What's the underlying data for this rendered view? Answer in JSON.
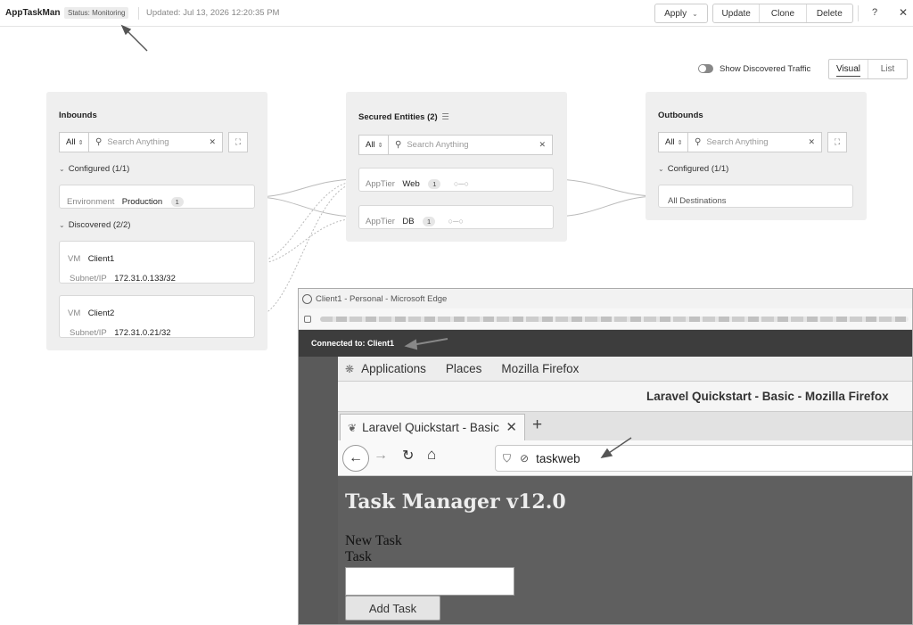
{
  "header": {
    "app_name": "AppTaskMan",
    "status": "Status: Monitoring",
    "updated": "Updated: Jul 13, 2026 12:20:35 PM",
    "apply": "Apply",
    "apply_chevron": "⌄",
    "update": "Update",
    "clone": "Clone",
    "delete": "Delete",
    "help": "?",
    "close": "✕"
  },
  "view": {
    "show_traffic": "Show Discovered Traffic",
    "visual": "Visual",
    "list": "List"
  },
  "inbounds": {
    "title": "Inbounds",
    "filter": "All",
    "search_placeholder": "Search Anything",
    "configured": "Configured (1/1)",
    "env_label": "Environment",
    "env_value": "Production",
    "env_count": "1",
    "discovered": "Discovered (2/2)",
    "clients": [
      {
        "type": "VM",
        "name": "Client1",
        "ip_label": "Subnet/IP",
        "ip": "172.31.0.133/32"
      },
      {
        "type": "VM",
        "name": "Client2",
        "ip_label": "Subnet/IP",
        "ip": "172.31.0.21/32"
      }
    ]
  },
  "secured": {
    "title": "Secured Entities (2)",
    "filter": "All",
    "search_placeholder": "Search Anything",
    "entities": [
      {
        "label": "AppTier",
        "value": "Web",
        "count": "1"
      },
      {
        "label": "AppTier",
        "value": "DB",
        "count": "1"
      }
    ]
  },
  "outbounds": {
    "title": "Outbounds",
    "filter": "All",
    "search_placeholder": "Search Anything",
    "configured": "Configured (1/1)",
    "destination": "All Destinations"
  },
  "edge": {
    "title": "Client1 - Personal - Microsoft Edge",
    "connected": "Connected to: Client1"
  },
  "remote": {
    "menu": [
      "Applications",
      "Places",
      "Mozilla Firefox"
    ],
    "window_title": "Laravel Quickstart - Basic - Mozilla Firefox",
    "tab_title": "Laravel Quickstart - Basic",
    "url": "taskweb",
    "heading": "Task Manager v12.0",
    "new_task": "New Task",
    "task_label": "Task",
    "add_button": "Add Task"
  }
}
